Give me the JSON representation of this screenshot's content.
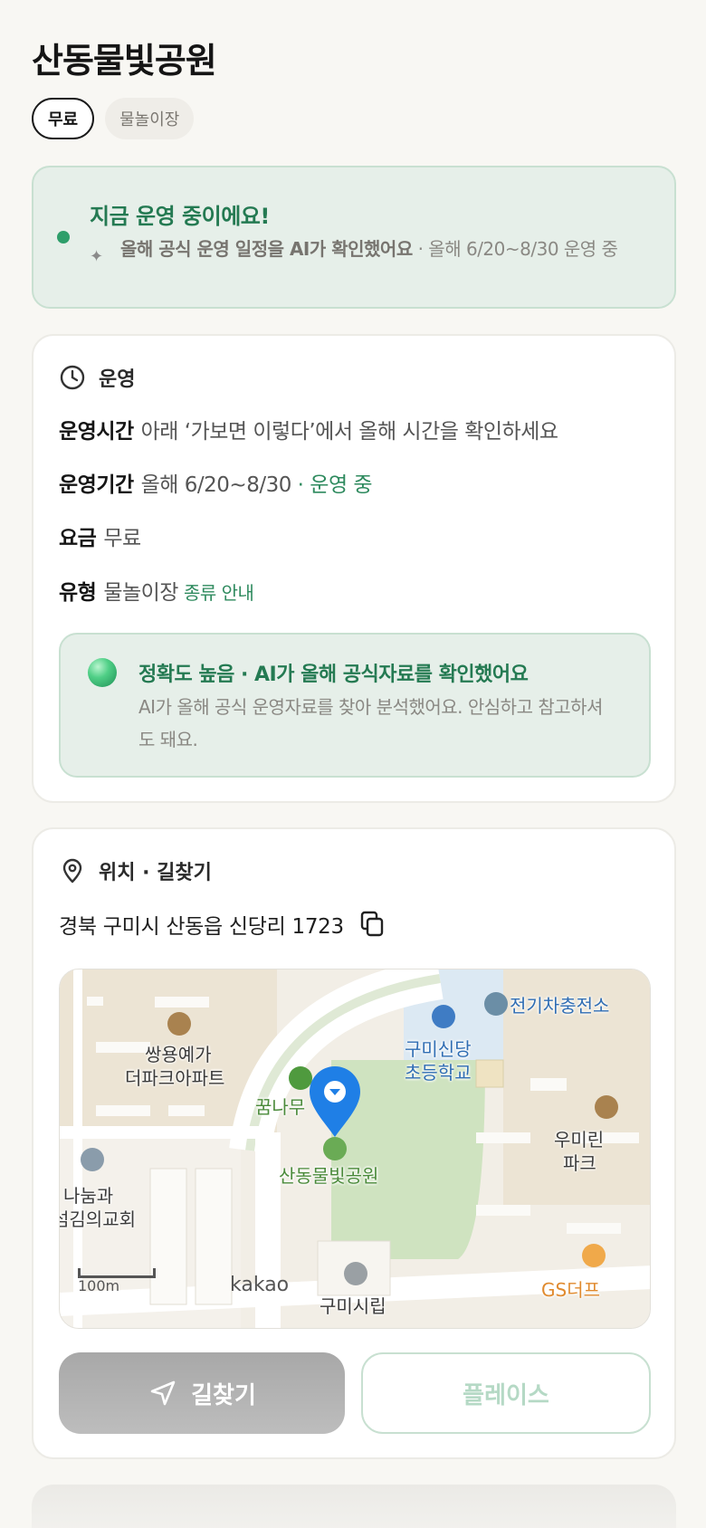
{
  "page": {
    "title": "산동물빛공원",
    "chips": [
      "무료",
      "물놀이장"
    ]
  },
  "status": {
    "title": "지금 운영 중이에요!",
    "sub_bold": "올해 공식 운영 일정을 AI가 확인했어요",
    "sub_rest": " · 올해 6/20~8/30 운영 중",
    "dot_color": "#2e9e6a"
  },
  "operation": {
    "heading": "운영",
    "hours_label": "운영시간",
    "hours_value": "아래 ‘가보면 이렇다’에서 올해 시간을 확인하세요",
    "period_label": "운영기간",
    "period_value": "올해 6/20~8/30",
    "period_status": "· 운영 중",
    "fee_label": "요금",
    "fee_value": "무료",
    "type_label": "유형",
    "type_value": "물놀이장",
    "type_link": "종류 안내",
    "accuracy_title": "정확도 높음 · AI가 올해 공식자료를 확인했어요",
    "accuracy_desc": "AI가 올해 공식 운영자료를 찾아 분석했어요. 안심하고 참고하셔도 돼요."
  },
  "location": {
    "heading": "위치 · 길찾기",
    "address": "경북 구미시 산동읍 신당리 1723",
    "map_labels": {
      "ev": "전기차충전소",
      "school_1": "구미신당",
      "school_2": "초등학교",
      "apt_1": "쌍용예가",
      "apt_2": "더파크아파트",
      "dream": "꿈나무",
      "park": "산동물빛공원",
      "church_1": "나눔과",
      "church_2": "섬김의교회",
      "right_1": "우미린",
      "right_2": "파크",
      "library": "구미시립",
      "gs": "GS더프",
      "scale": "100m",
      "provider": "kakao"
    },
    "route_button": "길찾기",
    "place_button": "플레이스"
  },
  "colors": {
    "accent_green": "#247a52",
    "banner_bg": "#e6efe9",
    "map_pin": "#1f7fe6"
  }
}
